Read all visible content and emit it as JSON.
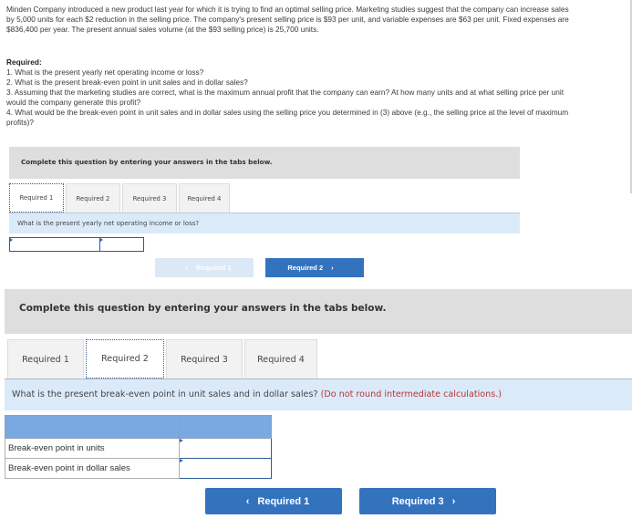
{
  "problem": {
    "text": "Minden Company introduced a new product last year for which it is trying to find an optimal selling price. Marketing studies suggest that the company can increase sales by 5,000 units for each $2 reduction in the selling price. The company's present selling price is $93 per unit, and variable expenses are $63 per unit. Fixed expenses are $836,400 per year. The present annual sales volume (at the $93 selling price) is 25,700 units."
  },
  "required": {
    "heading": "Required:",
    "items": [
      "1. What is the present yearly net operating income or loss?",
      "2. What is the present break-even point in unit sales and in dollar sales?",
      "3. Assuming that the marketing studies are correct, what is the maximum annual profit that the company can earn? At how many units and at what selling price per unit would the company generate this profit?",
      "4. What would be the break-even point in unit sales and in dollar sales using the selling price you determined in (3) above (e.g., the selling price at the level of maximum profits)?"
    ]
  },
  "panel1": {
    "banner": "Complete this question by entering your answers in the tabs below.",
    "tabs": [
      "Required 1",
      "Required 2",
      "Required 3",
      "Required 4"
    ],
    "active_tab": "Required 1",
    "question": "What is the present yearly net operating income or loss?",
    "inputs": [
      "",
      ""
    ],
    "prev_label": "Required 1",
    "next_label": "Required 2",
    "prev_enabled": false
  },
  "panel2": {
    "banner": "Complete this question by entering your answers in the tabs below.",
    "tabs": [
      "Required 1",
      "Required 2",
      "Required 3",
      "Required 4"
    ],
    "active_tab": "Required 2",
    "question": "What is the present break-even point in unit sales and in dollar sales?",
    "note": "(Do not round intermediate calculations.)",
    "table": {
      "rows": [
        {
          "label": "Break-even point in units",
          "value": ""
        },
        {
          "label": "Break-even point in dollar sales",
          "value": ""
        }
      ]
    },
    "prev_label": "Required 1",
    "next_label": "Required 3"
  },
  "icons": {
    "chevron_left": "‹",
    "chevron_right": "›"
  },
  "colors": {
    "primary_button": "#3373be",
    "disabled_button": "#dce8f5",
    "question_bar": "#dbeaf9",
    "banner": "#dedede",
    "table_header": "#79a9e0",
    "note_red": "#b8343a"
  }
}
